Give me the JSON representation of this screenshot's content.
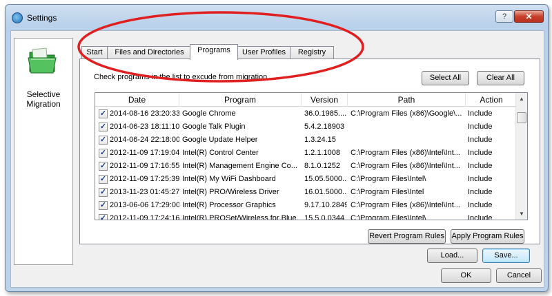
{
  "window": {
    "title": "Settings",
    "help_label": "?",
    "close_label": "✕"
  },
  "nav": {
    "label": "Selective Migration",
    "icon": "green-folder-icon"
  },
  "tabs": [
    {
      "label": "Start"
    },
    {
      "label": "Files and Directories"
    },
    {
      "label": "Programs"
    },
    {
      "label": "User Profiles"
    },
    {
      "label": "Registry"
    }
  ],
  "active_tab": "Programs",
  "programs": {
    "instruction": "Check programs in the list to excude from migration",
    "select_all": "Select All",
    "clear_all": "Clear All",
    "columns": {
      "date": "Date",
      "program": "Program",
      "version": "Version",
      "path": "Path",
      "action": "Action"
    },
    "rows": [
      {
        "checked": true,
        "date": "2014-08-16 23:20:33",
        "program": "Google Chrome",
        "version": "36.0.1985....",
        "path": "C:\\Program Files (x86)\\Google\\...",
        "action": "Include"
      },
      {
        "checked": true,
        "date": "2014-06-23 18:11:10",
        "program": "Google Talk Plugin",
        "version": "5.4.2.18903",
        "path": "",
        "action": "Include"
      },
      {
        "checked": true,
        "date": "2014-06-24 22:18:00",
        "program": "Google Update Helper",
        "version": "1.3.24.15",
        "path": "",
        "action": "Include"
      },
      {
        "checked": true,
        "date": "2012-11-09 17:19:04",
        "program": "Intel(R) Control Center",
        "version": "1.2.1.1008",
        "path": "C:\\Program Files (x86)\\Intel\\Int...",
        "action": "Include"
      },
      {
        "checked": true,
        "date": "2012-11-09 17:16:55",
        "program": "Intel(R) Management Engine Co...",
        "version": "8.1.0.1252",
        "path": "C:\\Program Files (x86)\\Intel\\Int...",
        "action": "Include"
      },
      {
        "checked": true,
        "date": "2012-11-09 17:25:39",
        "program": "Intel(R) My WiFi Dashboard",
        "version": "15.05.5000...",
        "path": "C:\\Program Files\\Intel\\",
        "action": "Include"
      },
      {
        "checked": true,
        "date": "2013-11-23 01:45:27",
        "program": "Intel(R) PRO/Wireless Driver",
        "version": "16.01.5000...",
        "path": "C:\\Program Files\\Intel",
        "action": "Include"
      },
      {
        "checked": true,
        "date": "2013-06-06 17:29:00",
        "program": "Intel(R) Processor Graphics",
        "version": "9.17.10.2849",
        "path": "C:\\Program Files (x86)\\Intel\\Int...",
        "action": "Include"
      },
      {
        "checked": true,
        "date": "2012-11-09 17:24:16",
        "program": "Intel(R) PROSet/Wireless for Blue...",
        "version": "15.5.0.0344",
        "path": "C:\\Program Files\\Intel\\",
        "action": "Include"
      }
    ],
    "revert_rules": "Revert Program Rules",
    "apply_rules": "Apply Program Rules"
  },
  "footer": {
    "load": "Load...",
    "save": "Save...",
    "ok": "OK",
    "cancel": "Cancel"
  },
  "colors": {
    "annotation": "#e02020",
    "title_gradient_top": "#cfe0f1",
    "close_button": "#c7402c"
  }
}
